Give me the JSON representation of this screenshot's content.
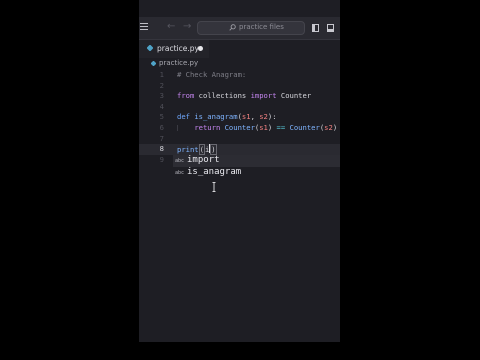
{
  "topbar": {
    "search_placeholder": "practice files",
    "back_label": "←",
    "forward_label": "→"
  },
  "tabs": [
    {
      "label": "practice.py",
      "dirty": true
    }
  ],
  "breadcrumb": {
    "file": "practice.py"
  },
  "editor": {
    "current_line": 8,
    "lines": [
      {
        "num": "1",
        "text": "# Check Anagram:"
      },
      {
        "num": "2",
        "text": ""
      },
      {
        "num": "3",
        "text": "from collections import Counter"
      },
      {
        "num": "4",
        "text": ""
      },
      {
        "num": "5",
        "text": "def is_anagram(s1, s2):"
      },
      {
        "num": "6",
        "text": "    return Counter(s1) == Counter(s2)"
      },
      {
        "num": "7",
        "text": ""
      },
      {
        "num": "8",
        "text": "print(i)"
      },
      {
        "num": "9",
        "text": ""
      }
    ]
  },
  "autocomplete": {
    "items": [
      {
        "icon": "abc",
        "label": "import"
      },
      {
        "icon": "abc",
        "label": "is_anagram"
      }
    ]
  },
  "colors": {
    "background": "#1e1e24",
    "keyword": "#c586f0",
    "function": "#7fb4ff",
    "param": "#f08080",
    "comment": "#7d7d86",
    "python_icon": "#4fa3c7"
  }
}
